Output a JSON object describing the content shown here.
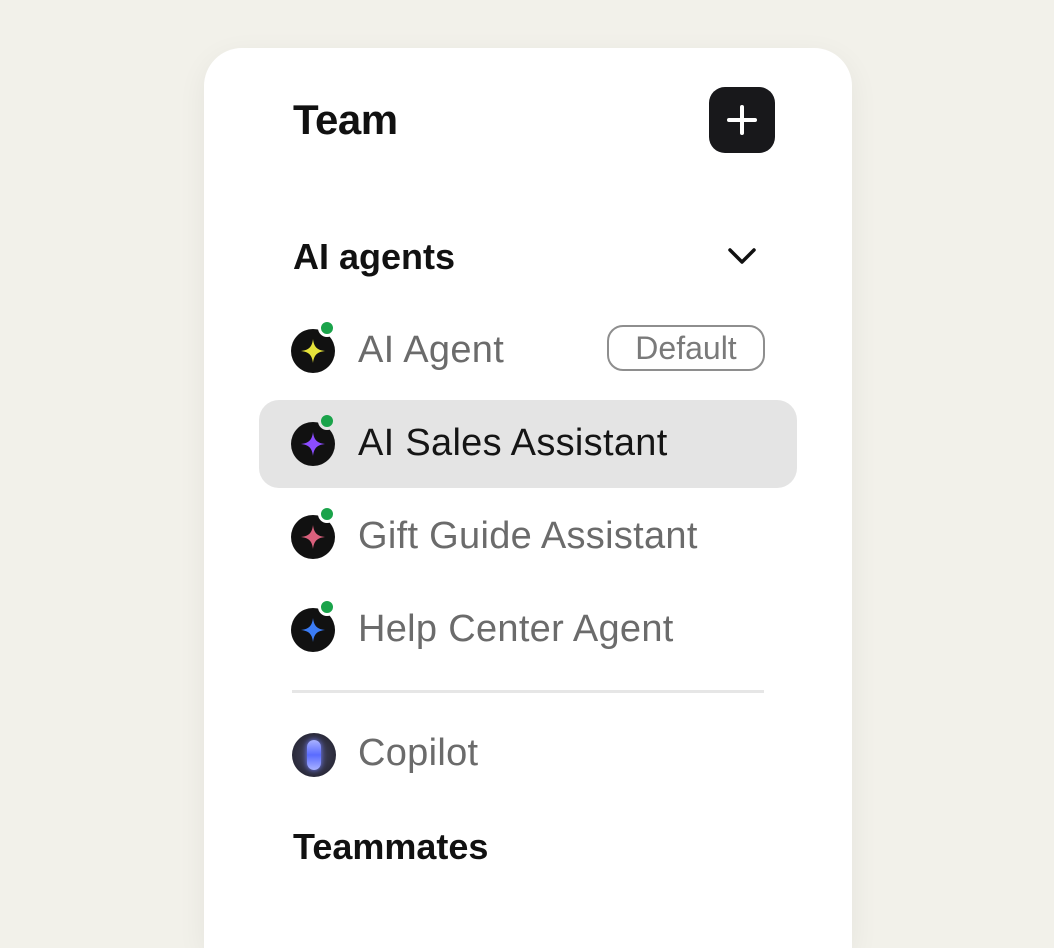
{
  "header": {
    "title": "Team",
    "add_icon": "plus-icon"
  },
  "sections": {
    "ai_agents": {
      "title": "AI agents",
      "toggle_icon": "chevron-down-icon"
    },
    "teammates": {
      "title": "Teammates"
    }
  },
  "agents": [
    {
      "label": "AI Agent",
      "badge": "Default",
      "star_color": "#e6e33a",
      "status": "online",
      "selected": false
    },
    {
      "label": "AI Sales Assistant",
      "star_color": "#8b4cff",
      "status": "online",
      "selected": true
    },
    {
      "label": "Gift Guide Assistant",
      "star_color": "#d9607c",
      "status": "online",
      "selected": false
    },
    {
      "label": "Help Center Agent",
      "star_color": "#3b7cf5",
      "status": "online",
      "selected": false
    }
  ],
  "copilot": {
    "label": "Copilot",
    "icon": "copilot-icon"
  },
  "colors": {
    "background": "#f2f1ea",
    "panel": "#ffffff",
    "selected_row": "#e4e4e4",
    "status_online": "#1aa34a",
    "add_button": "#18181b"
  }
}
